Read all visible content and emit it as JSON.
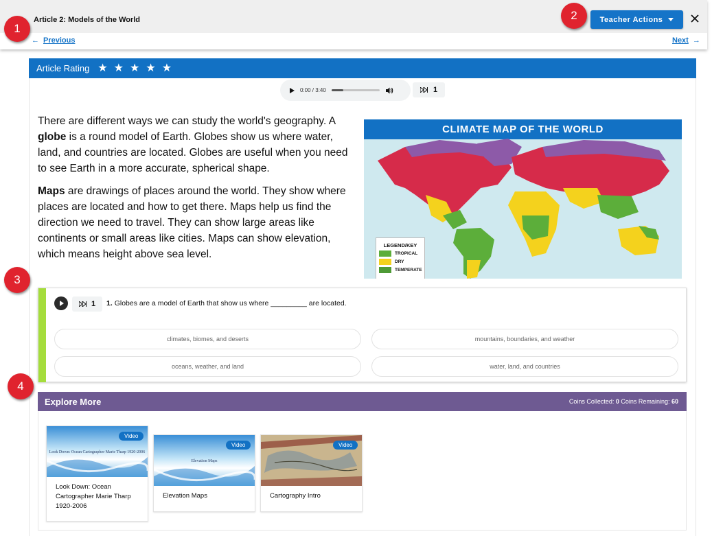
{
  "header": {
    "article_title": "Article 2: Models of the World",
    "teacher_actions_label": "Teacher Actions",
    "previous_label": "Previous",
    "next_label": "Next"
  },
  "annotations": [
    "1",
    "2",
    "3",
    "4"
  ],
  "rating": {
    "label": "Article Rating",
    "star_count": 5
  },
  "audio": {
    "time": "0:00 / 3:40",
    "progress": 0,
    "speed": "1"
  },
  "article": {
    "p1_pre": "There are different ways we can study the world's geography. A ",
    "p1_bold": "globe",
    "p1_post": " is a round model of Earth. Globes show us where water, land, and countries are located. Globes are useful when you need to see Earth in a more accurate, spherical shape.",
    "p2_bold": "Maps",
    "p2_post": " are drawings of places around the world. They show where places are located and how to get there. Maps help us find the direction we need to travel. They can show large areas like continents or small areas like cities. Maps can show elevation, which means height above sea level."
  },
  "map": {
    "title": "CLIMATE MAP OF THE WORLD",
    "legend_title": "LEGEND/KEY",
    "legend": [
      {
        "label": "TROPICAL",
        "color": "#5cae3a"
      },
      {
        "label": "DRY",
        "color": "#f4d21d"
      },
      {
        "label": "TEMPERATE",
        "color": "#4e9a36"
      }
    ]
  },
  "question": {
    "speed": "1",
    "number": "1.",
    "text": "Globes are a model of Earth that show us where _________ are located.",
    "options": [
      "climates, biomes, and deserts",
      "mountains, boundaries, and weather",
      "oceans, weather, and land",
      "water, land, and countries"
    ]
  },
  "explore": {
    "title": "Explore More",
    "coins_collected_label": "Coins Collected:",
    "coins_collected": "0",
    "coins_remaining_label": "Coins Remaining:",
    "coins_remaining": "60",
    "cards": [
      {
        "badge": "Video",
        "title": "Look Down: Ocean Cartographer Marie Tharp 1920-2006",
        "thumb_text": "Look Down: Ocean Cartographer Marie Tharp 1920-2006"
      },
      {
        "badge": "Video",
        "title": "Elevation Maps",
        "thumb_text": "Elevation Maps"
      },
      {
        "badge": "Video",
        "title": "Cartography Intro",
        "thumb_text": ""
      }
    ]
  },
  "colors": {
    "primary_blue": "#1271c4",
    "explore_purple": "#6e5a92",
    "question_accent": "#a5dd3c",
    "annotation_red": "#e0232e"
  }
}
